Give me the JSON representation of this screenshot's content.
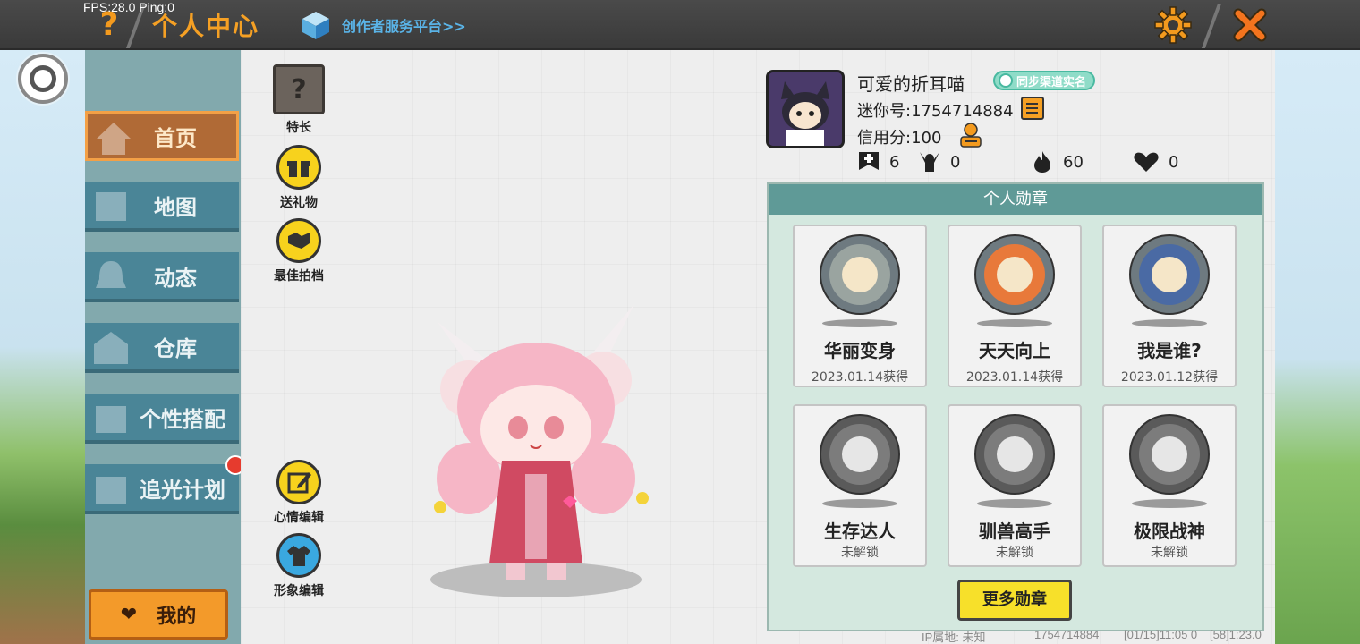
{
  "debug": {
    "fps_text": "FPS:28.0  Ping:0"
  },
  "header": {
    "help_label": "?",
    "title": "个人中心",
    "creator_link": "创作者服务平台>>",
    "settings_icon": "gear-icon",
    "close_icon": "close-icon"
  },
  "sidebar": {
    "items": [
      {
        "label": "首页",
        "active": true
      },
      {
        "label": "地图",
        "active": false
      },
      {
        "label": "动态",
        "active": false
      },
      {
        "label": "仓库",
        "active": false
      },
      {
        "label": "个性搭配",
        "active": false
      },
      {
        "label": "追光计划",
        "active": false,
        "badge": true
      }
    ],
    "mine_label": "我的"
  },
  "actions": {
    "talent": "特长",
    "gift": "送礼物",
    "partner": "最佳拍档",
    "mood": "心情编辑",
    "image": "形象编辑"
  },
  "profile": {
    "nickname": "可爱的折耳喵",
    "verify_label": "同步渠道实名",
    "mini_id": "迷你号:1754714884",
    "credit": "信用分:100",
    "stats": [
      {
        "icon": "add-friend-icon",
        "value": "6"
      },
      {
        "icon": "fans-icon",
        "value": "0"
      },
      {
        "icon": "fire-icon",
        "value": "60"
      },
      {
        "icon": "heart-icon",
        "value": "0"
      }
    ]
  },
  "medals": {
    "header": "个人勋章",
    "items": [
      {
        "name": "华丽变身",
        "status": "2023.01.14获得",
        "locked": false,
        "color": "#9aa4a0"
      },
      {
        "name": "天天向上",
        "status": "2023.01.14获得",
        "locked": false,
        "color": "#e8793a"
      },
      {
        "name": "我是谁?",
        "status": "2023.01.12获得",
        "locked": false,
        "color": "#4a6aa4"
      },
      {
        "name": "生存达人",
        "status": "未解锁",
        "locked": true,
        "color": "#7c7c7c"
      },
      {
        "name": "驯兽高手",
        "status": "未解锁",
        "locked": true,
        "color": "#7c7c7c"
      },
      {
        "name": "极限战神",
        "status": "未解锁",
        "locked": true,
        "color": "#7c7c7c"
      }
    ],
    "more_label": "更多勋章"
  },
  "footer": {
    "ip_location": "IP属地: 未知",
    "uid": "1754714884",
    "time1": "[01/15]11:05 0",
    "time2": "[58]1:23.0"
  }
}
